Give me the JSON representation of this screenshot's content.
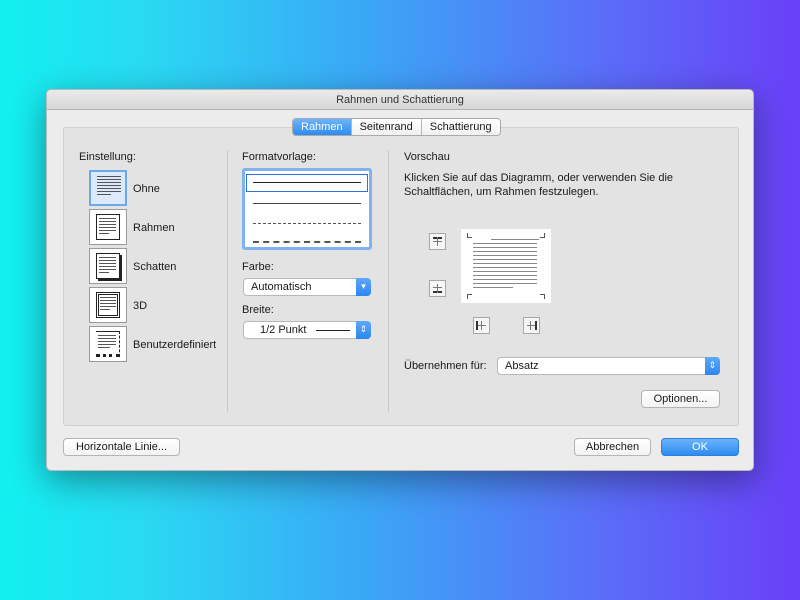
{
  "window": {
    "title": "Rahmen und Schattierung"
  },
  "tabs": [
    {
      "label": "Rahmen",
      "active": true
    },
    {
      "label": "Seitenrand",
      "active": false
    },
    {
      "label": "Schattierung",
      "active": false
    }
  ],
  "einstellung": {
    "label": "Einstellung:",
    "items": [
      {
        "label": "Ohne",
        "icon": "none-border-icon"
      },
      {
        "label": "Rahmen",
        "icon": "box-border-icon"
      },
      {
        "label": "Schatten",
        "icon": "shadow-border-icon"
      },
      {
        "label": "3D",
        "icon": "3d-border-icon"
      },
      {
        "label": "Benutzerdefiniert",
        "icon": "custom-border-icon"
      }
    ]
  },
  "format": {
    "label": "Formatvorlage:",
    "farbe_label": "Farbe:",
    "farbe_value": "Automatisch",
    "breite_label": "Breite:",
    "breite_value": "1/2 Punkt"
  },
  "vorschau": {
    "label": "Vorschau",
    "instructions": "Klicken Sie auf das Diagramm, oder verwenden Sie die Schaltflächen, um Rahmen festzulegen.",
    "apply_label": "Übernehmen für:",
    "apply_value": "Absatz",
    "options_button": "Optionen..."
  },
  "footer": {
    "horizontal_line_button": "Horizontale Linie...",
    "cancel_button": "Abbrechen",
    "ok_button": "OK"
  },
  "colors": {
    "accent": "#2d8cf0",
    "dialog_bg": "#ececec",
    "panel_bg": "#e3e3e3"
  }
}
